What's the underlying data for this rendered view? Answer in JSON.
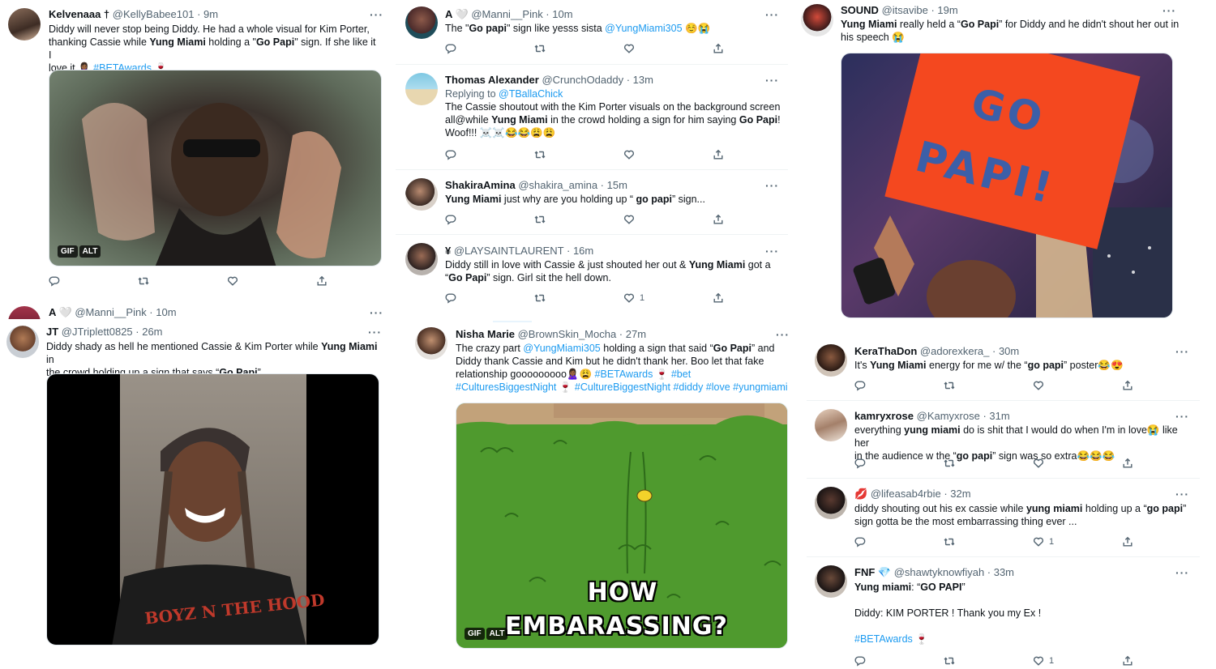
{
  "colors": {
    "link": "#1d9bf0",
    "muted": "#536471"
  },
  "tweets": {
    "t1": {
      "name": "Kelvenaaa †",
      "handle": "@KellyBabee101 · 9m",
      "l1": "Diddy will never stop being Diddy. He had a whole visual for Kim Porter,",
      "l2a": "thanking Cassie while ",
      "l2b": "Yung Miami",
      "l2c": " holding a \"",
      "l2d": "Go Papi",
      "l2e": "\" sign. If she like it I",
      "l3a": "love it 🙎🏾‍♀️ ",
      "l3b": "#BETAwards",
      "l3c": " 🍷",
      "gif": "GIF",
      "alt": "ALT"
    },
    "t2": {
      "name": "A 🤍",
      "handle": "@Manni__Pink · 10m"
    },
    "t3": {
      "name": "JT",
      "handle": "@JTriplett0825 · 26m",
      "l1a": "Diddy shady as hell he mentioned Cassie & Kim Porter while ",
      "l1b": "Yung Miami",
      "l1c": " in",
      "l2a": "the crowd holding up a sign that says “",
      "l2b": "Go Papi",
      "l2c": "”",
      "shirt": "BOYZ N THE HOOD"
    },
    "m1": {
      "name": "A 🤍",
      "handle": "@Manni__Pink · 10m",
      "a": "The \"",
      "b": "Go papi",
      "c": "\" sign like yesss sista ",
      "d": "@YungMiami305",
      "e": " ☺️😭"
    },
    "m2": {
      "name": "Thomas Alexander",
      "handle": "@CrunchOdaddy · 13m",
      "reply": "Replying to ",
      "reply_to": "@TBallaChick",
      "l1": "The Cassie shoutout with the Kim Porter visuals on the background screen",
      "l2a": "all@while ",
      "l2b": "Yung Miami",
      "l2c": " in the crowd holding a sign for him saying ",
      "l2d": "Go Papi",
      "l2e": "!",
      "l3": "Woof!!! ☠️☠️😂😂😩😩"
    },
    "m3": {
      "name": "ShakiraAmina",
      "handle": "@shakira_amina · 15m",
      "a": "Yung Miami",
      "b": " just why are you holding up “ ",
      "c": "go papi",
      "d": "” sign..."
    },
    "m4": {
      "name": "¥",
      "handle": "@LAYSAINTLAURENT · 16m",
      "l1a": "Diddy still in love with Cassie & just shouted her out & ",
      "l1b": "Yung Miami",
      "l1c": " got a",
      "l2a": "“",
      "l2b": "Go Papi",
      "l2c": "” sign. Girl sit the hell down.",
      "likes": "1"
    },
    "m5": {
      "name": "Nisha Marie",
      "handle": "@BrownSkin_Mocha · 27m",
      "l1a": "The crazy part ",
      "l1b": "@YungMiami305",
      "l1c": " holding a sign that said “",
      "l1d": "Go Papi",
      "l1e": "” and",
      "l2": "Diddy thank Cassie and Kim but he didn't thank her. Boo let that fake",
      "l3a": "relationship gooooooooo🙎🏾‍♀️😩 ",
      "l3b": "#BETAwards",
      "l3c": " 🍷 ",
      "l3d": "#bet",
      "l4a": "#CulturesBiggestNight",
      "l4b": " 🍷 ",
      "l4c": "#CultureBiggestNight #diddy #love #yungmiami",
      "gif_text1": "HOW",
      "gif_text2": "EMBARASSING?",
      "gif": "GIF",
      "alt": "ALT"
    },
    "r1": {
      "name": "SOUND",
      "handle": "@itsavibe · 19m",
      "l1a": "Yung Miami",
      "l1b": " really held a “",
      "l1c": "Go Papi",
      "l1d": "” for Diddy and he didn't shout her out in",
      "l2": "his speech 😭",
      "sign1": "GO",
      "sign2": "PAPI!"
    },
    "r2": {
      "name": "KeraThaDon",
      "handle": "@adorexkera_ · 30m",
      "a": "It's ",
      "b": "Yung Miami",
      "c": " energy for me w/ the “",
      "d": "go papi",
      "e": "” poster😂😍"
    },
    "r3": {
      "name": "kamryxrose",
      "handle": "@Kamyxrose · 31m",
      "l1a": "everything ",
      "l1b": "yung miami",
      "l1c": " do is shit that I would do when I'm in love😭 like her",
      "l2a": "in the audience w the “",
      "l2b": "go papi",
      "l2c": "” sign was so extra😂😂😂"
    },
    "r4": {
      "name": "💋",
      "handle": "@lifeasab4rbie · 32m",
      "l1a": "diddy shouting out his ex cassie while ",
      "l1b": "yung miami",
      "l1c": " holding up a “",
      "l1d": "go papi",
      "l1e": "”",
      "l2": "sign gotta be the most embarrassing thing ever ...",
      "likes": "1"
    },
    "r5": {
      "name": "FNF 💎",
      "handle": "@shawtyknowfiyah · 33m",
      "l1a": "Yung miami",
      "l1b": ": “",
      "l1c": "GO PAPI",
      "l1d": "”",
      "l2": "Diddy: KIM PORTER ! Thank you my Ex !",
      "l3a": "#BETAwards",
      "l3b": " 🍷",
      "likes": "1"
    }
  }
}
